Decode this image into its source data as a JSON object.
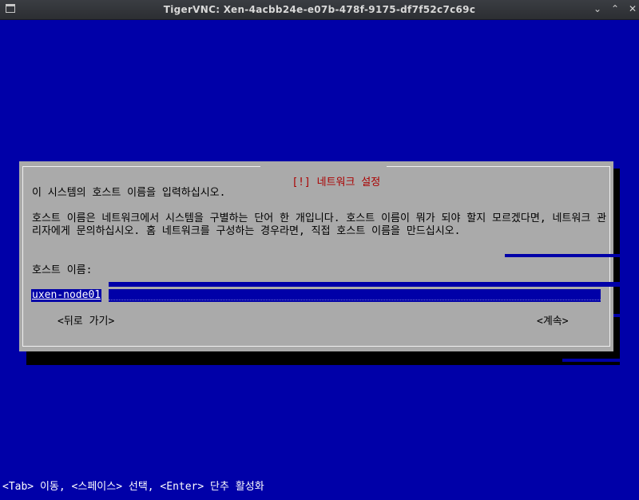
{
  "window": {
    "title": "TigerVNC: Xen-4acbb24e-e07b-478f-9175-df7f52c7c69c",
    "controls": {
      "minimize": "⌄",
      "maximize": "⌃",
      "close": "✕"
    }
  },
  "dialog": {
    "title": "[!] 네트워크 설정",
    "prompt": "이 시스템의 호스트 이름을 입력하십시오.",
    "description": "호스트 이름은 네트워크에서 시스템을 구별하는 단어 한 개입니다. 호스트 이름이 뭐가 되야 할지 모르겠다면, 네트워크 관리자에게 문의하십시오. 홈 네트워크를 구성하는 경우라면, 직접 호스트 이름을 만드십시오.",
    "field_label": "호스트 이름:",
    "field_value": "uxen-node01",
    "back_button": "<뒤로 가기>",
    "continue_button": "<계속>"
  },
  "statusbar": {
    "text": "<Tab> 이동, <스페이스> 선택, <Enter> 단추 활성화"
  },
  "colors": {
    "background": "#0000a8",
    "dialog": "#aaaaaa",
    "title_text": "#aa0000",
    "field_bg": "#0000a8"
  }
}
